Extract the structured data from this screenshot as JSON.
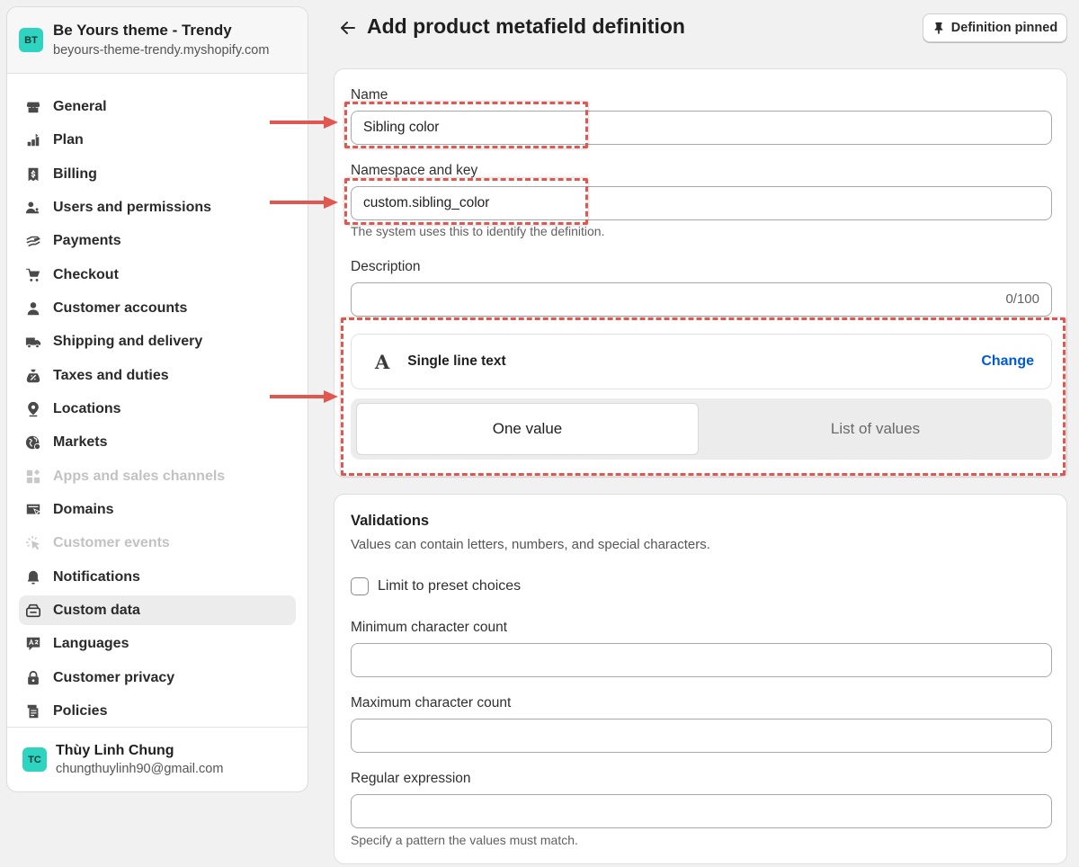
{
  "store": {
    "initials": "BT",
    "name": "Be Yours theme - Trendy",
    "url": "beyours-theme-trendy.myshopify.com"
  },
  "nav": [
    {
      "label": "General",
      "icon": "store-icon",
      "active": false,
      "disabled": false
    },
    {
      "label": "Plan",
      "icon": "plan-icon",
      "active": false,
      "disabled": false
    },
    {
      "label": "Billing",
      "icon": "billing-icon",
      "active": false,
      "disabled": false
    },
    {
      "label": "Users and permissions",
      "icon": "users-icon",
      "active": false,
      "disabled": false
    },
    {
      "label": "Payments",
      "icon": "payments-icon",
      "active": false,
      "disabled": false
    },
    {
      "label": "Checkout",
      "icon": "cart-icon",
      "active": false,
      "disabled": false
    },
    {
      "label": "Customer accounts",
      "icon": "person-icon",
      "active": false,
      "disabled": false
    },
    {
      "label": "Shipping and delivery",
      "icon": "truck-icon",
      "active": false,
      "disabled": false
    },
    {
      "label": "Taxes and duties",
      "icon": "tax-icon",
      "active": false,
      "disabled": false
    },
    {
      "label": "Locations",
      "icon": "location-icon",
      "active": false,
      "disabled": false
    },
    {
      "label": "Markets",
      "icon": "globe-icon",
      "active": false,
      "disabled": false
    },
    {
      "label": "Apps and sales channels",
      "icon": "apps-icon",
      "active": false,
      "disabled": true
    },
    {
      "label": "Domains",
      "icon": "domains-icon",
      "active": false,
      "disabled": false
    },
    {
      "label": "Customer events",
      "icon": "cursor-icon",
      "active": false,
      "disabled": true
    },
    {
      "label": "Notifications",
      "icon": "bell-icon",
      "active": false,
      "disabled": false
    },
    {
      "label": "Custom data",
      "icon": "custom-data-icon",
      "active": true,
      "disabled": false
    },
    {
      "label": "Languages",
      "icon": "languages-icon",
      "active": false,
      "disabled": false
    },
    {
      "label": "Customer privacy",
      "icon": "lock-icon",
      "active": false,
      "disabled": false
    },
    {
      "label": "Policies",
      "icon": "policies-icon",
      "active": false,
      "disabled": false
    }
  ],
  "user": {
    "initials": "TC",
    "name": "Thùy Linh Chung",
    "email": "chungthuylinh90@gmail.com"
  },
  "header": {
    "title": "Add product metafield definition",
    "pinned_label": "Definition pinned"
  },
  "definition": {
    "name_label": "Name",
    "name_value": "Sibling color",
    "namespace_label": "Namespace and key",
    "namespace_value": "custom.sibling_color",
    "namespace_help": "The system uses this to identify the definition.",
    "description_label": "Description",
    "description_value": "",
    "description_counter": "0/100",
    "type_icon": "A",
    "type_label": "Single line text",
    "change_label": "Change",
    "one_value_label": "One value",
    "list_values_label": "List of values",
    "selected_value_mode": "One value"
  },
  "validations": {
    "title": "Validations",
    "subtitle": "Values can contain letters, numbers, and special characters.",
    "preset_label": "Limit to preset choices",
    "preset_checked": false,
    "min_label": "Minimum character count",
    "min_value": "",
    "max_label": "Maximum character count",
    "max_value": "",
    "regex_label": "Regular expression",
    "regex_value": "",
    "regex_help": "Specify a pattern the values must match."
  },
  "colors": {
    "annotation": "#e0574f",
    "link": "#005bd3",
    "avatar": "#2fd4c0"
  }
}
